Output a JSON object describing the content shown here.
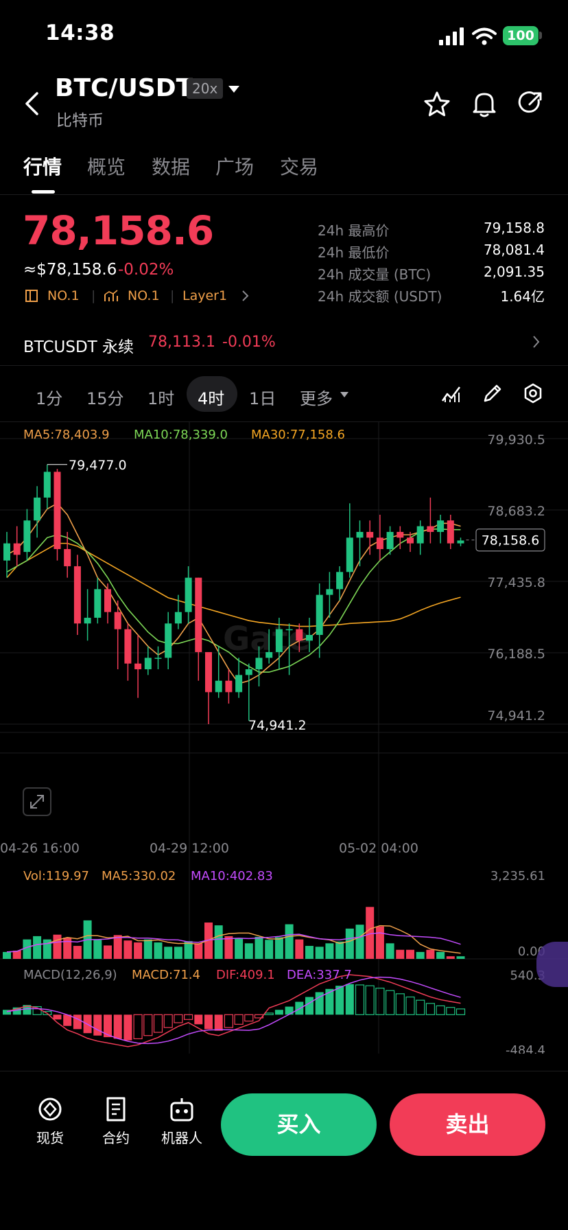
{
  "status_bar": {
    "time": "14:38",
    "battery": "100"
  },
  "header": {
    "pair": "BTC/USDT",
    "leverage": "20x",
    "subtitle": "比特币",
    "icons": [
      "back-icon",
      "chevron-down-icon",
      "star-icon",
      "bell-icon",
      "share-icon"
    ]
  },
  "tabs": [
    {
      "label": "行情",
      "active": true
    },
    {
      "label": "概览"
    },
    {
      "label": "数据"
    },
    {
      "label": "广场"
    },
    {
      "label": "交易"
    }
  ],
  "price": {
    "last": "78,158.6",
    "usd": "≈$78,158.6",
    "change": "-0.02%",
    "tags": [
      "NO.1",
      "NO.1",
      "Layer1"
    ]
  },
  "stats": [
    {
      "label": "24h 最高价",
      "value": "79,158.8"
    },
    {
      "label": "24h 最低价",
      "value": "78,081.4"
    },
    {
      "label": "24h 成交量 (BTC)",
      "value": "2,091.35"
    },
    {
      "label": "24h 成交额 (USDT)",
      "value": "1.64亿"
    }
  ],
  "perpetual": {
    "label": "BTCUSDT 永续",
    "price": "78,113.1",
    "change": "-0.01%"
  },
  "intervals": [
    {
      "label": "1分"
    },
    {
      "label": "15分"
    },
    {
      "label": "1时"
    },
    {
      "label": "4时",
      "active": true
    },
    {
      "label": "1日"
    },
    {
      "label": "更多"
    }
  ],
  "chart_data": {
    "type": "candlestick",
    "ma_labels": {
      "ma5": "MA5:78,403.9",
      "ma10": "MA10:78,339.0",
      "ma30": "MA30:77,158.6"
    },
    "y_ticks": [
      "79,930.5",
      "78,683.2",
      "77,435.8",
      "76,188.5",
      "74,941.2"
    ],
    "ylim": [
      74941.2,
      79930.5
    ],
    "x_labels": [
      "04-26 16:00",
      "04-29 12:00",
      "05-02 04:00"
    ],
    "high_marker": "79,477.0",
    "low_marker": "74,941.2",
    "current_price_tag": "78,158.6",
    "colors": {
      "up": "#20c281",
      "down": "#f23c57",
      "ma5": "#f0a04a",
      "ma10": "#7ed957",
      "ma30": "#f5a623"
    },
    "candles": [
      [
        77800,
        78100,
        78300,
        77500
      ],
      [
        78100,
        77900,
        78400,
        77700
      ],
      [
        77950,
        78500,
        78700,
        77800
      ],
      [
        78500,
        78900,
        79100,
        78200
      ],
      [
        78900,
        79350,
        79477,
        78700
      ],
      [
        79350,
        78000,
        79400,
        77800
      ],
      [
        78000,
        77700,
        78300,
        77500
      ],
      [
        77700,
        76700,
        77900,
        76500
      ],
      [
        76700,
        76800,
        77300,
        76400
      ],
      [
        76800,
        77300,
        77500,
        76700
      ],
      [
        77300,
        76900,
        77400,
        76700
      ],
      [
        76900,
        76600,
        77100,
        75900
      ],
      [
        76600,
        76000,
        76700,
        75700
      ],
      [
        76000,
        75900,
        76500,
        75400
      ],
      [
        75900,
        76100,
        76300,
        75800
      ],
      [
        76100,
        76100,
        76300,
        75900
      ],
      [
        76100,
        76700,
        76900,
        75900
      ],
      [
        76700,
        76900,
        77200,
        76600
      ],
      [
        76900,
        77500,
        77700,
        76700
      ],
      [
        77500,
        76200,
        77500,
        75700
      ],
      [
        76200,
        75500,
        76100,
        74941
      ],
      [
        75500,
        75700,
        76300,
        75400
      ],
      [
        75700,
        75500,
        75900,
        75300
      ],
      [
        75500,
        75800,
        76100,
        75400
      ],
      [
        75800,
        75900,
        76000,
        75000
      ],
      [
        75900,
        76100,
        76300,
        75600
      ],
      [
        76100,
        76200,
        76600,
        76000
      ],
      [
        76200,
        76600,
        76800,
        75900
      ],
      [
        76600,
        76600,
        76700,
        75800
      ],
      [
        76600,
        76400,
        76700,
        76200
      ],
      [
        76400,
        76500,
        76800,
        76200
      ],
      [
        76500,
        77200,
        77400,
        76100
      ],
      [
        77200,
        77300,
        77600,
        76800
      ],
      [
        77300,
        77600,
        77700,
        77100
      ],
      [
        77600,
        78200,
        78800,
        77500
      ],
      [
        78200,
        78300,
        78500,
        77700
      ],
      [
        78300,
        78200,
        78500,
        77900
      ],
      [
        78200,
        78000,
        78600,
        77800
      ],
      [
        78000,
        78300,
        78400,
        77900
      ],
      [
        78300,
        78200,
        78400,
        78000
      ],
      [
        78200,
        78100,
        78300,
        77950
      ],
      [
        78100,
        78400,
        78500,
        77900
      ],
      [
        78400,
        78300,
        78900,
        78100
      ],
      [
        78300,
        78500,
        78600,
        78100
      ],
      [
        78500,
        78100,
        78600,
        78000
      ],
      [
        78100,
        78150,
        78200,
        78050
      ]
    ],
    "ma5": [
      77900,
      78000,
      78200,
      78450,
      78700,
      78800,
      78600,
      78250,
      77900,
      77500,
      77300,
      77000,
      76700,
      76500,
      76300,
      76150,
      76250,
      76450,
      76700,
      76800,
      76500,
      76200,
      75900,
      75650,
      75700,
      75800,
      75950,
      76100,
      76300,
      76400,
      76450,
      76600,
      76850,
      77100,
      77450,
      77800,
      78050,
      78150,
      78200,
      78250,
      78250,
      78300,
      78350,
      78450,
      78450,
      78400
    ],
    "ma10": [
      77600,
      77700,
      77800,
      78000,
      78200,
      78250,
      78200,
      78100,
      77950,
      77750,
      77500,
      77200,
      76950,
      76750,
      76550,
      76400,
      76350,
      76350,
      76400,
      76450,
      76400,
      76300,
      76200,
      76050,
      75950,
      75850,
      75850,
      75900,
      75950,
      76050,
      76150,
      76300,
      76500,
      76750,
      77050,
      77350,
      77600,
      77800,
      77950,
      78100,
      78200,
      78300,
      78350,
      78350,
      78340,
      78339
    ],
    "ma30": [
      77500,
      77700,
      77800,
      77900,
      78000,
      78100,
      78100,
      78050,
      77950,
      77850,
      77750,
      77650,
      77550,
      77450,
      77350,
      77250,
      77150,
      77100,
      77050,
      77000,
      76950,
      76900,
      76850,
      76800,
      76750,
      76720,
      76700,
      76680,
      76670,
      76650,
      76650,
      76660,
      76670,
      76680,
      76700,
      76710,
      76720,
      76730,
      76740,
      76780,
      76850,
      76930,
      77000,
      77060,
      77110,
      77158.6
    ],
    "volume": {
      "labels": {
        "vol": "Vol:119.97",
        "ma5": "MA5:330.02",
        "ma10": "MA10:402.83"
      },
      "y_ticks": [
        "3,235.61",
        "0.00"
      ],
      "values": [
        320,
        380,
        900,
        1050,
        900,
        1120,
        980,
        600,
        1780,
        880,
        620,
        1100,
        850,
        760,
        900,
        760,
        560,
        560,
        820,
        720,
        1680,
        1550,
        1050,
        960,
        720,
        1020,
        880,
        1000,
        1600,
        900,
        600,
        560,
        720,
        800,
        1400,
        1580,
        2400,
        1500,
        720,
        420,
        420,
        320,
        420,
        320,
        120,
        119.97
      ]
    },
    "macd": {
      "labels": {
        "params": "MACD(12,26,9)",
        "macd": "MACD:71.4",
        "dif": "DIF:409.1",
        "dea": "DEA:337.7"
      },
      "y_ticks": [
        "540.3",
        "-484.4"
      ],
      "hist": [
        60,
        90,
        120,
        100,
        40,
        -60,
        -140,
        -180,
        -230,
        -260,
        -280,
        -300,
        -320,
        -300,
        -260,
        -220,
        -160,
        -100,
        -60,
        -120,
        -180,
        -200,
        -160,
        -120,
        -80,
        -40,
        20,
        60,
        100,
        160,
        220,
        280,
        320,
        360,
        380,
        370,
        360,
        330,
        300,
        260,
        220,
        180,
        140,
        110,
        90,
        71.4
      ]
    }
  },
  "bottom_nav": [
    {
      "label": "现货",
      "icon": "spot-icon"
    },
    {
      "label": "合约",
      "icon": "contract-icon"
    },
    {
      "label": "机器人",
      "icon": "robot-icon"
    }
  ],
  "actions": {
    "buy": "买入",
    "sell": "卖出"
  }
}
